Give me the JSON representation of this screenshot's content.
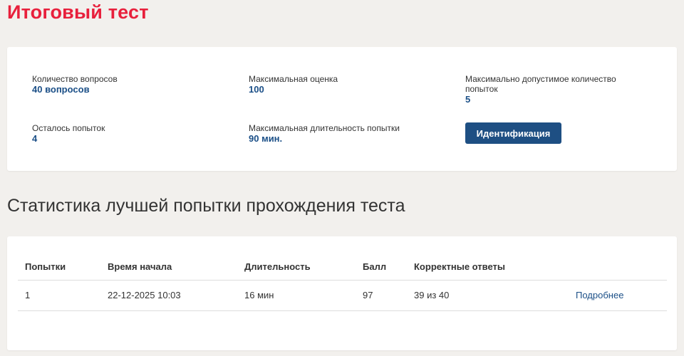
{
  "page": {
    "title": "Итоговый тест"
  },
  "info": {
    "questions_label": "Количество вопросов",
    "questions_value": "40 вопросов",
    "max_grade_label": "Максимальная оценка",
    "max_grade_value": "100",
    "max_attempts_label": "Максимально допустимое количество попыток",
    "max_attempts_value": "5",
    "attempts_left_label": "Осталось попыток",
    "attempts_left_value": "4",
    "max_duration_label": "Максимальная длительность попытки",
    "max_duration_value": "90 мин.",
    "identification_button": "Идентификация"
  },
  "stats": {
    "title": "Статистика лучшей попытки прохождения теста",
    "columns": {
      "attempt": "Попытки",
      "start_time": "Время начала",
      "duration": "Длительность",
      "score": "Балл",
      "correct": "Корректные ответы"
    },
    "rows": [
      {
        "attempt": "1",
        "start_time": "22-12-2025 10:03",
        "duration": "16 мин",
        "score": "97",
        "correct": "39 из 40",
        "details_link": "Подробнее"
      }
    ]
  },
  "colors": {
    "title_red": "#e8203c",
    "accent_blue": "#1e4f83",
    "background": "#f2f0ed"
  }
}
